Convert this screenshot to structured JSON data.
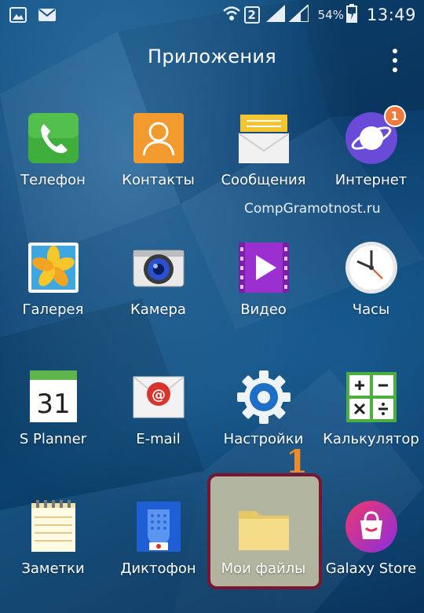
{
  "status_bar": {
    "sim_slot": "2",
    "battery": "54%",
    "time": "13:49",
    "icons": [
      "gallery-icon",
      "mail-icon",
      "wifi-icon",
      "signal-icon",
      "battery-charging-icon"
    ]
  },
  "header": {
    "title": "Приложения",
    "menu_icon": "more-vert-icon"
  },
  "watermark": "CompGramotnost.ru",
  "apps": {
    "phone": {
      "label": "Телефон",
      "icon": "phone-icon"
    },
    "contacts": {
      "label": "Контакты",
      "icon": "contacts-icon"
    },
    "messages": {
      "label": "Сообщения",
      "icon": "envelope-icon"
    },
    "internet": {
      "label": "Интернет",
      "icon": "internet-planet-icon",
      "badge": "1"
    },
    "gallery": {
      "label": "Галерея",
      "icon": "gallery-flower-icon"
    },
    "camera": {
      "label": "Камера",
      "icon": "camera-icon"
    },
    "video": {
      "label": "Видео",
      "icon": "video-play-icon"
    },
    "clock": {
      "label": "Часы",
      "icon": "clock-icon"
    },
    "splanner": {
      "label": "S Planner",
      "icon": "calendar-icon",
      "day": "31"
    },
    "email": {
      "label": "E-mail",
      "icon": "email-at-icon"
    },
    "settings": {
      "label": "Настройки",
      "icon": "gear-icon"
    },
    "calculator": {
      "label": "Калькулятор",
      "icon": "calculator-icon"
    },
    "notes": {
      "label": "Заметки",
      "icon": "notepad-icon"
    },
    "recorder": {
      "label": "Диктофон",
      "icon": "microphone-icon"
    },
    "myfiles": {
      "label": "Мои файлы",
      "icon": "folder-icon"
    },
    "galaxystore": {
      "label": "Galaxy Store",
      "icon": "shopping-bag-icon"
    }
  },
  "annotation": {
    "step": "1"
  },
  "colors": {
    "highlight_border": "#7a1530",
    "highlight_fill": "#dcd2aa",
    "step_number": "#f08a2a",
    "badge": "#f07a3d"
  }
}
